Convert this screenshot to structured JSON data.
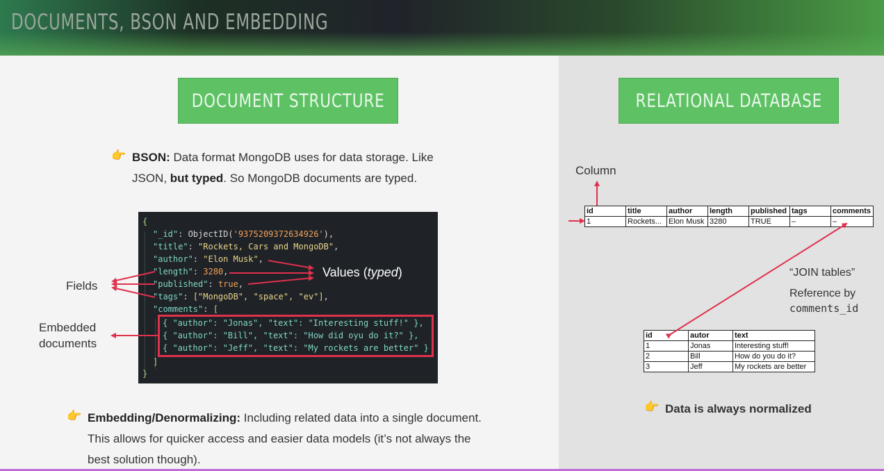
{
  "header": {
    "title": "DOCUMENTS, BSON AND EMBEDDING"
  },
  "left": {
    "section_title": "DOCUMENT STRUCTURE",
    "bson_bullet": {
      "bold": "BSON:",
      "text1": " Data format MongoDB uses for data storage. Like",
      "text2a": "JSON, ",
      "bold2": "but typed",
      "text2b": ". So MongoDB documents are typed."
    },
    "code": {
      "open": "{",
      "id_key": "\"_id\"",
      "id_fn": "ObjectID(",
      "id_val": "'9375209372634926'",
      "id_end": "),",
      "title_key": "\"title\"",
      "title_val": "\"Rockets, Cars and MongoDB\"",
      "author_key": "\"author\"",
      "author_val": "\"Elon Musk\"",
      "length_key": "\"length\"",
      "length_val": "3280",
      "published_key": "\"published\"",
      "published_val": "true",
      "tags_key": "\"tags\"",
      "tags_val": "[\"MongoDB\", \"space\", \"ev\"]",
      "comments_key": "\"comments\"",
      "comments_open": "[",
      "c1": "{ \"author\": \"Jonas\", \"text\": \"Interesting stuff!\" },",
      "c2": "{ \"author\": \"Bill\", \"text\": \"How did oyu do it?\" },",
      "c3": "{ \"author\": \"Jeff\", \"text\": \"My rockets are better\" }",
      "comments_close": "]",
      "close": "}"
    },
    "labels": {
      "fields": "Fields",
      "values_prefix": "Values (",
      "values_typed": "typed",
      "values_suffix": ")",
      "embedded_line1": "Embedded",
      "embedded_line2": "documents"
    },
    "embedding_bullet": {
      "bold": "Embedding/Denormalizing:",
      "text1": " Including related data into a single document.",
      "text2": "This allows for quicker access and easier data models (it’s not always the",
      "text3": "best solution though)."
    }
  },
  "right": {
    "section_title": "RELATIONAL DATABASE",
    "column_label": "Column",
    "main_table": {
      "headers": [
        "id",
        "title",
        "author",
        "length",
        "published",
        "tags",
        "comments"
      ],
      "row": [
        "1",
        "Rockets...",
        "Elon Musk",
        "3280",
        "TRUE",
        "–",
        "–"
      ]
    },
    "join_label": "“JOIN tables”",
    "reference_label": "Reference by",
    "reference_field": "comments_id",
    "comments_table": {
      "headers": [
        "id",
        "autor",
        "text"
      ],
      "rows": [
        [
          "1",
          "Jonas",
          "Interesting stuff!"
        ],
        [
          "2",
          "Bill",
          "How do you do it?"
        ],
        [
          "3",
          "Jeff",
          "My rockets are better"
        ]
      ]
    },
    "normalized_bullet": "Data is always normalized"
  },
  "colors": {
    "accent_green": "#5ec265",
    "arrow_red": "#e0314d",
    "code_bg": "#1f2227"
  }
}
